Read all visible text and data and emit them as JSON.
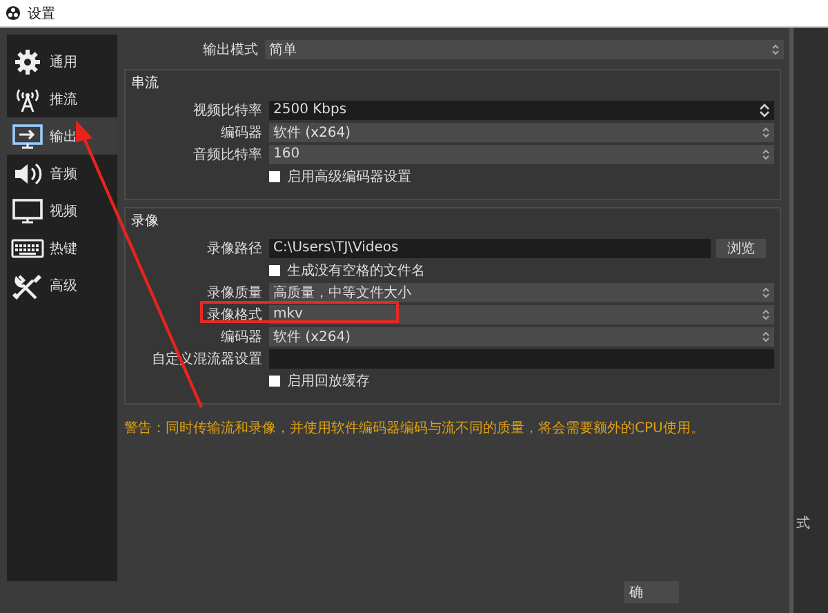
{
  "window": {
    "title": "设置"
  },
  "sidebar": {
    "items": [
      {
        "label": "通用",
        "selected": false
      },
      {
        "label": "推流",
        "selected": false
      },
      {
        "label": "输出",
        "selected": true
      },
      {
        "label": "音频",
        "selected": false
      },
      {
        "label": "视频",
        "selected": false
      },
      {
        "label": "热键",
        "selected": false
      },
      {
        "label": "高级",
        "selected": false
      }
    ]
  },
  "output_mode": {
    "label": "输出模式",
    "value": "简单"
  },
  "streaming": {
    "title": "串流",
    "fields": [
      {
        "kind": "spinbox",
        "label": "视频比特率",
        "value": "2500 Kbps"
      },
      {
        "kind": "dropdown",
        "label": "编码器",
        "value": "软件 (x264)"
      },
      {
        "kind": "dropdown",
        "label": "音频比特率",
        "value": "160"
      },
      {
        "kind": "checkbox",
        "label": "启用高级编码器设置",
        "checked": false
      }
    ]
  },
  "recording": {
    "title": "录像",
    "fields": [
      {
        "kind": "path",
        "label": "录像路径",
        "value": "C:\\Users\\TJ\\Videos",
        "button": "浏览"
      },
      {
        "kind": "checkbox",
        "label": "生成没有空格的文件名",
        "checked": false
      },
      {
        "kind": "dropdown",
        "label": "录像质量",
        "value": "高质量，中等文件大小"
      },
      {
        "kind": "dropdown",
        "label": "录像格式",
        "value": "mkv",
        "highlighted": true
      },
      {
        "kind": "dropdown",
        "label": "编码器",
        "value": "软件 (x264)"
      },
      {
        "kind": "text",
        "label": "自定义混流器设置"
      },
      {
        "kind": "checkbox",
        "label": "启用回放缓存",
        "checked": false
      }
    ]
  },
  "warning": "警告：同时传输流和录像，并使用软件编码器编码与流不同的质量，将会需要额外的CPU使用。",
  "footer_button": "确",
  "background_window": {
    "label": "式"
  },
  "annotations": [
    {
      "kind": "arrow"
    }
  ]
}
